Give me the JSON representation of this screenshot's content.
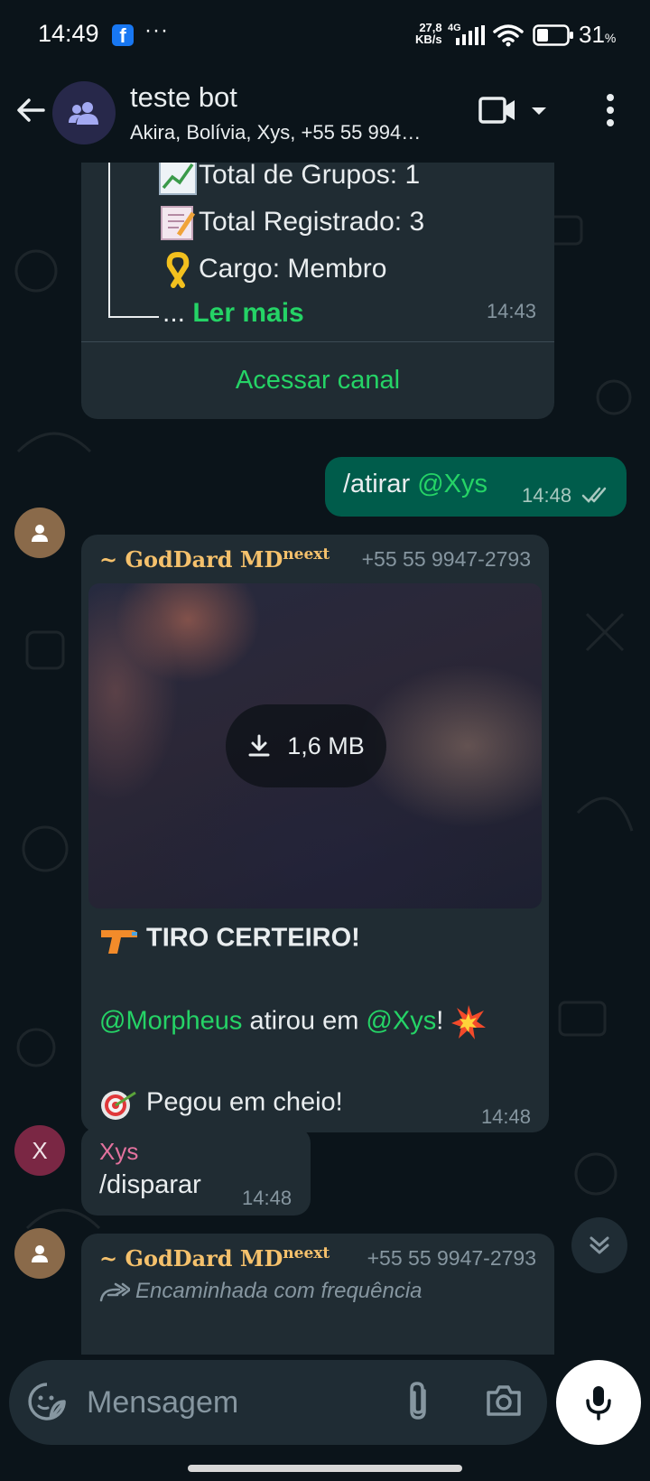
{
  "status_bar": {
    "time": "14:49",
    "overflow": "···",
    "net_speed_value": "27,8",
    "net_speed_unit": "KB/s",
    "network_type": "4G",
    "battery_value": "31",
    "battery_unit": "%"
  },
  "header": {
    "title": "teste bot",
    "subtitle": "Akira, Bolívia, Xys, +55 55 994…"
  },
  "messages": [
    {
      "lines": [
        "Total de Grupos: 1",
        "Total Registrado: 3",
        "Cargo: Membro"
      ],
      "read_more_prefix": "... ",
      "read_more": "Ler mais",
      "time": "14:43",
      "action": "Acessar canal"
    },
    {
      "command": "/atirar ",
      "mention": "@Xys",
      "time": "14:48"
    },
    {
      "sender_name": "~ GodDard MD",
      "sender_suffix": "neext",
      "sender_phone": "+55 55 9947-2793",
      "media_size": "1,6 MB",
      "title": "TIRO CERTEIRO!",
      "mention_a": "@Morpheus",
      "middle": " atirou em ",
      "mention_b": "@Xys",
      "after": "! ",
      "last_line": " Pegou em cheio!",
      "time": "14:48"
    },
    {
      "avatar_letter": "X",
      "sender_name": "Xys",
      "text": "/disparar",
      "time": "14:48"
    },
    {
      "sender_name": "~ GodDard MD",
      "sender_suffix": "neext",
      "sender_phone": "+55 55 9947-2793",
      "forwarded": "Encaminhada com frequência"
    }
  ],
  "composer": {
    "placeholder": "Mensagem"
  },
  "icons": {
    "back": "arrow-left-icon",
    "group": "group-icon",
    "video": "video-call-icon",
    "more": "more-vert-icon",
    "download": "download-icon",
    "sticker": "sticker-icon",
    "attach": "paperclip-icon",
    "camera": "camera-icon",
    "mic": "mic-icon",
    "scroll": "double-chevron-down-icon"
  },
  "colors": {
    "background": "#0b141a",
    "incoming_bubble": "#202c33",
    "outgoing_bubble": "#005c4b",
    "accent_green": "#25d366",
    "bot_name": "#f5c16c",
    "xys_name": "#e3729e"
  }
}
